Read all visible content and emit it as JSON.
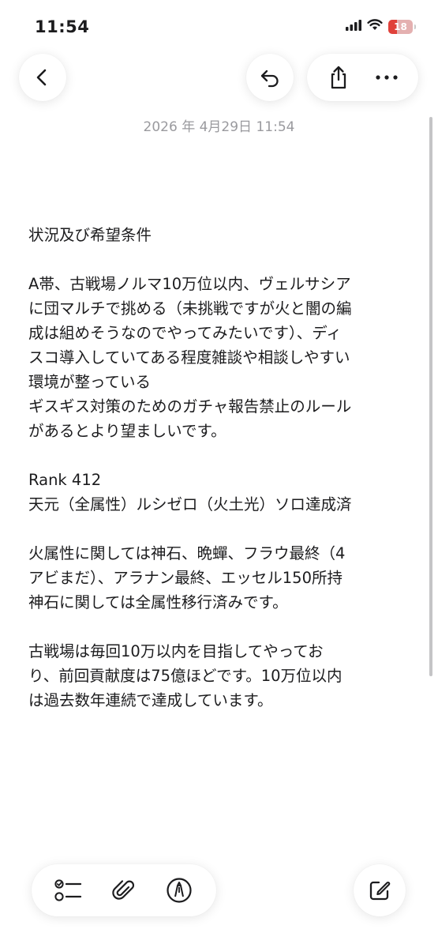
{
  "status_bar": {
    "time": "11:54",
    "battery": "18",
    "icons": [
      "cellular-signal-icon",
      "wifi-icon",
      "battery-icon"
    ]
  },
  "nav": {
    "icons": [
      "chevron-left-icon",
      "undo-icon",
      "share-icon",
      "ellipsis-icon"
    ]
  },
  "note": {
    "date": "2026 年 4月29日 11:54",
    "paragraphs": {
      "p1": "状況及び希望条件",
      "p2": "A帯、古戦場ノルマ10万位以内、ヴェルサシア\nに団マルチで挑める（未挑戦ですが火と闇の編\n成は組めそうなのでやってみたいです）、ディ\nスコ導入していてある程度雑談や相談しやすい\n環境が整っている\nギスギス対策のためのガチャ報告禁止のルール\nがあるとより望ましいです。",
      "p3": "Rank 412\n天元（全属性）ルシゼロ（火土光）ソロ達成済",
      "p4": "火属性に関しては神石、晩蟬、フラウ最終（4\nアビまだ）、アラナン最終、エッセル150所持\n神石に関しては全属性移行済みです。",
      "p5": "古戦場は毎回10万以内を目指してやってお\nり、前回貢献度は75億ほどです。10万位以内\nは過去数年連続で達成しています。"
    }
  },
  "toolbar": {
    "icons": [
      "checklist-icon",
      "paperclip-icon",
      "markup-pen-icon",
      "compose-icon"
    ]
  },
  "colors": {
    "battery": "#e0413a",
    "date_text": "#9a9a9e",
    "body_text": "#1c1c1e"
  }
}
